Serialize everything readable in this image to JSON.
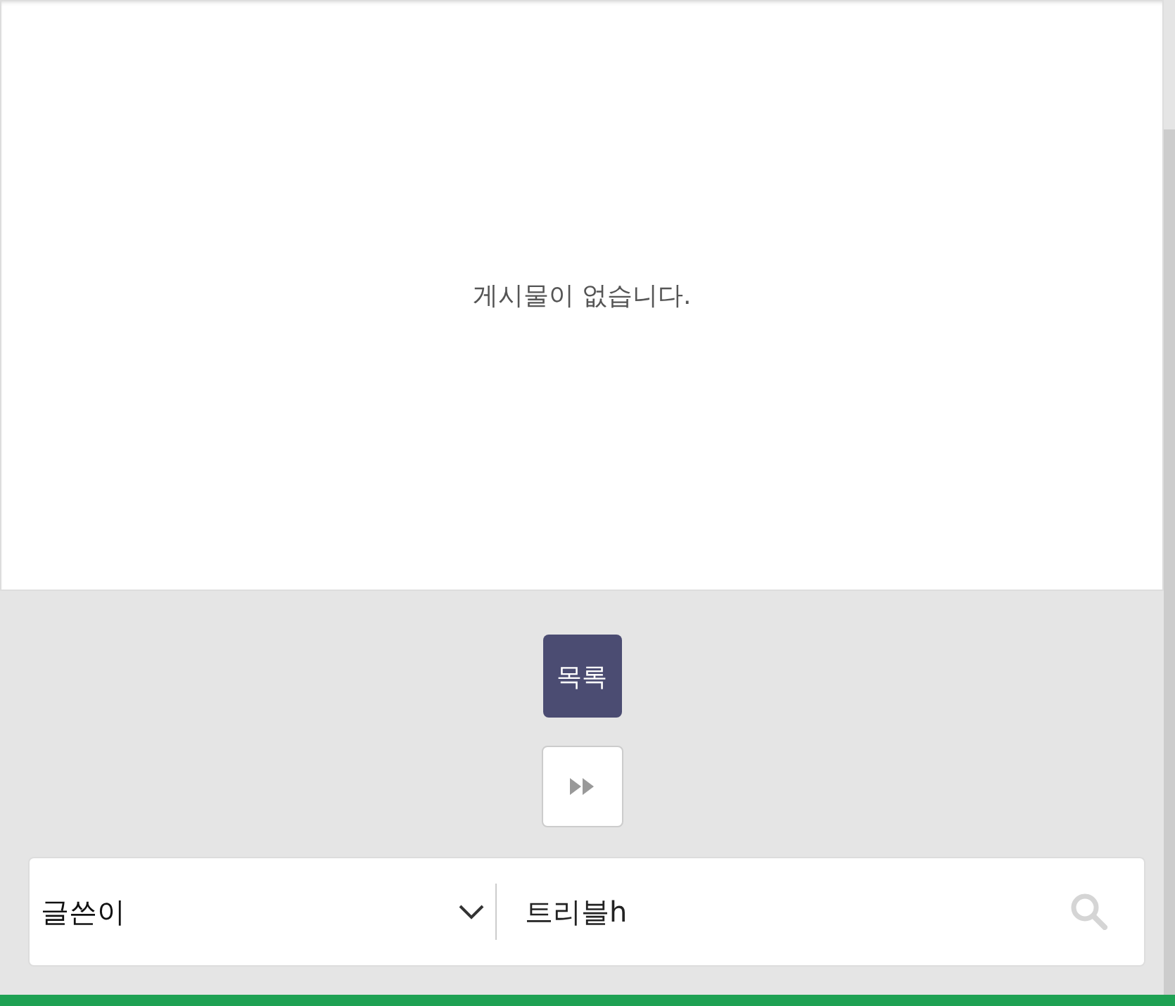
{
  "board": {
    "empty_message": "게시물이 없습니다."
  },
  "list_button": {
    "label": "목록"
  },
  "search": {
    "field_select": "글쓴이",
    "value": "트리블h"
  }
}
